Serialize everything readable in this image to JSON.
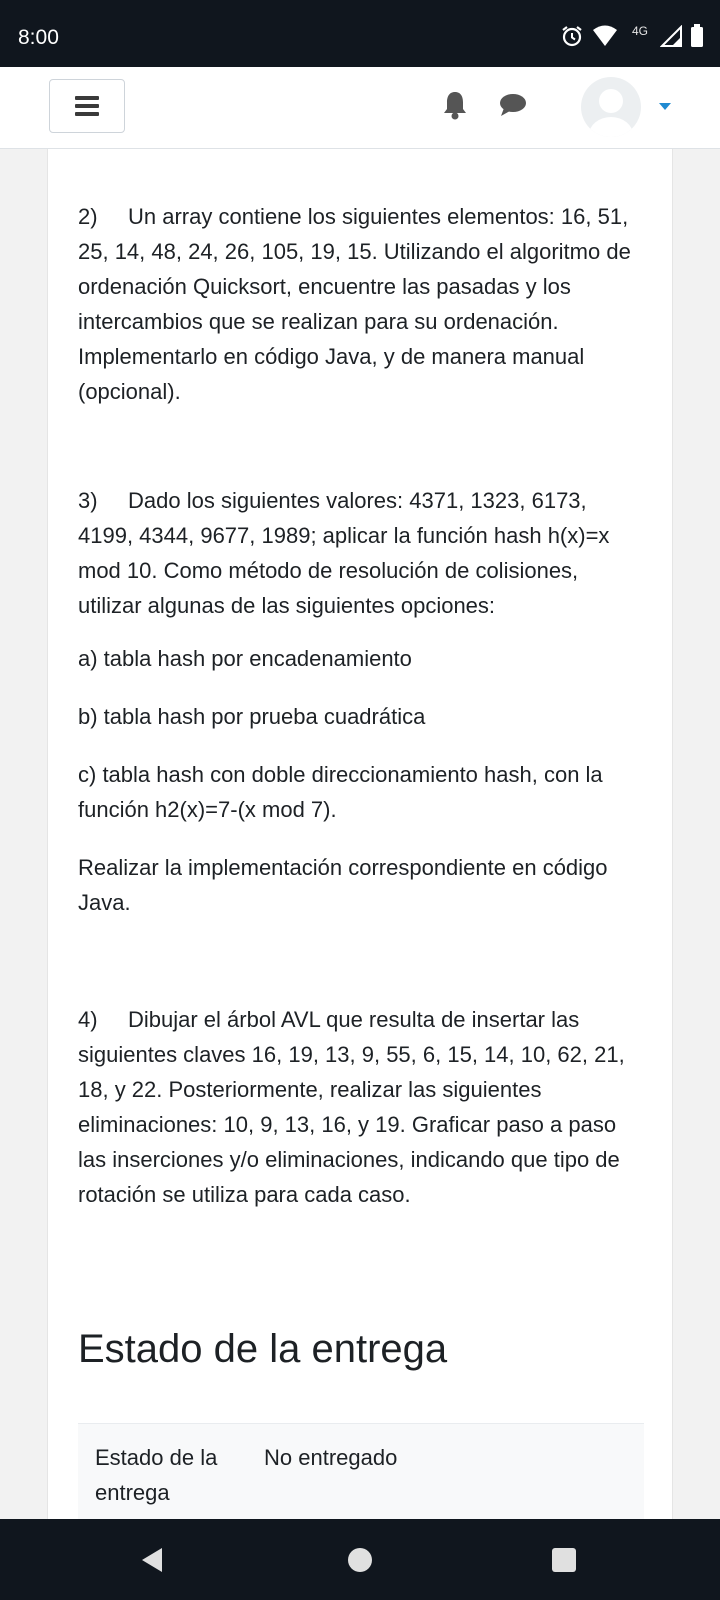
{
  "status_bar": {
    "time": "8:00",
    "network": "4G",
    "icons": [
      "alarm-icon",
      "wifi-icon",
      "signal-icon",
      "battery-icon"
    ]
  },
  "navbar": {
    "menu_icon": "hamburger-icon",
    "notifications_icon": "bell-icon",
    "messages_icon": "chat-icon",
    "user_menu_icon": "caret-down-icon",
    "accent": "#1f8ad1"
  },
  "questions": [
    {
      "number": "2)",
      "text": "Un array contiene los siguientes elementos: 16, 51, 25, 14, 48, 24, 26, 105, 19, 15. Utilizando el algoritmo de ordenación Quicksort, encuentre las pasadas y los intercambios que se realizan para su ordenación. Implementarlo en código Java, y de manera manual (opcional)."
    },
    {
      "number": "3)",
      "text": "Dado los siguientes valores: 4371, 1323, 6173, 4199, 4344, 9677, 1989; aplicar la función hash h(x)=x mod 10. Como método de resolución de colisiones, utilizar algunas de las siguientes opciones:",
      "options": [
        "a) tabla hash por encadenamiento",
        "b) tabla hash por prueba cuadrática",
        "c) tabla hash con doble direccionamiento hash, con la función h2(x)=7-(x mod 7)."
      ],
      "footer": "Realizar la implementación correspondiente en código Java."
    },
    {
      "number": "4)",
      "text": "Dibujar el árbol AVL que resulta de insertar las siguientes claves 16, 19, 13, 9, 55, 6, 15, 14, 10, 62, 21, 18, y 22. Posteriormente, realizar las siguientes eliminaciones: 10, 9, 13, 16, y 19. Graficar paso a paso las inserciones y/o eliminaciones, indicando que tipo de rotación se utiliza para cada caso."
    }
  ],
  "submission": {
    "title": "Estado de la entrega",
    "status_label": "Estado de la entrega",
    "status_value": "No entregado"
  },
  "bottom_nav": {
    "icons": [
      "back-icon",
      "home-icon",
      "recents-icon"
    ]
  }
}
